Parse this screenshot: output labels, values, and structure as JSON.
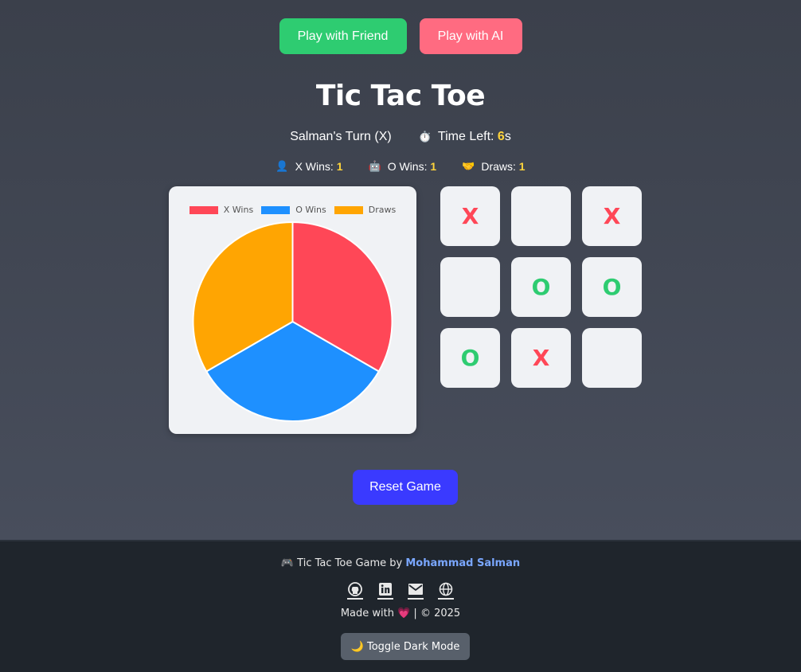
{
  "modes": {
    "friend_label": "Play with Friend",
    "ai_label": "Play with AI"
  },
  "title": "Tic Tac Toe",
  "status": {
    "turn": "Salman's Turn (X)",
    "time_prefix": "Time Left: ",
    "time_value": "6",
    "time_suffix": "s"
  },
  "scores": {
    "x_label": "X Wins: ",
    "x_value": "1",
    "o_label": "O Wins: ",
    "o_value": "1",
    "draws_label": "Draws: ",
    "draws_value": "1"
  },
  "board": [
    "X",
    "",
    "X",
    "",
    "O",
    "O",
    "O",
    "X",
    ""
  ],
  "reset_label": "Reset Game",
  "footer": {
    "credit_prefix": "Tic Tac Toe Game by ",
    "author": "Mohammad Salman",
    "made_prefix": "Made with ",
    "made_suffix": " | © 2025",
    "toggle_label": "Toggle Dark Mode"
  },
  "colors": {
    "x": "#ff4757",
    "o": "#1e90ff",
    "draws": "#ffa502",
    "x_mark": "#ff4757",
    "o_mark": "#2ecc71"
  },
  "chart_data": {
    "type": "pie",
    "categories": [
      "X Wins",
      "O Wins",
      "Draws"
    ],
    "values": [
      1,
      1,
      1
    ],
    "colors": [
      "#ff4757",
      "#1e90ff",
      "#ffa502"
    ],
    "legend": "top"
  }
}
